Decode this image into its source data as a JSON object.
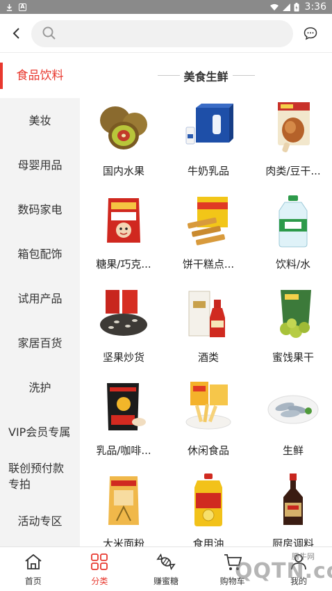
{
  "status_bar": {
    "time": "3:36",
    "icons": [
      "download-icon",
      "notification-a-icon",
      "wifi-icon",
      "signal-icon",
      "battery-icon"
    ]
  },
  "header": {
    "search_placeholder": "",
    "icons": [
      "back-arrow-icon",
      "search-icon",
      "message-icon"
    ]
  },
  "sidebar": {
    "items": [
      {
        "label": "食品饮料",
        "active": true
      },
      {
        "label": "美妆"
      },
      {
        "label": "母婴用品"
      },
      {
        "label": "数码家电"
      },
      {
        "label": "箱包配饰"
      },
      {
        "label": "试用产品"
      },
      {
        "label": "家居百货"
      },
      {
        "label": "洗护"
      },
      {
        "label": "VIP会员专属"
      },
      {
        "label": "联创预付款专拍"
      },
      {
        "label": "活动专区"
      }
    ]
  },
  "content": {
    "section_title": "美食生鲜",
    "categories": [
      {
        "label": "国内水果",
        "icon": "kiwi-fruit-image"
      },
      {
        "label": "牛奶乳品",
        "icon": "milk-box-image"
      },
      {
        "label": "肉类/豆干...",
        "icon": "chicken-leg-image"
      },
      {
        "label": "糖果/巧克...",
        "icon": "milk-candy-bag-image"
      },
      {
        "label": "饼干糕点...",
        "icon": "wafer-biscuit-image"
      },
      {
        "label": "饮料/水",
        "icon": "water-bottle-image"
      },
      {
        "label": "坚果炒货",
        "icon": "sunflower-seeds-image"
      },
      {
        "label": "酒类",
        "icon": "liquor-bottle-image"
      },
      {
        "label": "蜜饯果干",
        "icon": "dried-fruit-bag-image"
      },
      {
        "label": "乳品/咖啡...",
        "icon": "coffee-bag-image"
      },
      {
        "label": "休闲食品",
        "icon": "snack-fries-image"
      },
      {
        "label": "生鲜",
        "icon": "shrimp-plate-image"
      },
      {
        "label": "大米面粉",
        "icon": "rice-bag-image"
      },
      {
        "label": "食用油",
        "icon": "cooking-oil-image"
      },
      {
        "label": "厨房调料",
        "icon": "soy-sauce-image"
      }
    ]
  },
  "bottom_nav": {
    "items": [
      {
        "label": "首页",
        "icon": "home-icon"
      },
      {
        "label": "分类",
        "icon": "category-grid-icon",
        "active": true
      },
      {
        "label": "赚蜜糖",
        "icon": "candy-icon"
      },
      {
        "label": "购物车",
        "icon": "cart-icon"
      },
      {
        "label": "我的",
        "icon": "profile-icon"
      }
    ]
  },
  "watermark": {
    "small": "腾牛网",
    "big": "QQTN.com"
  },
  "colors": {
    "accent": "#e8382e",
    "sidebar_bg": "#f3f3f3",
    "status_bar": "#8a8a8a"
  }
}
